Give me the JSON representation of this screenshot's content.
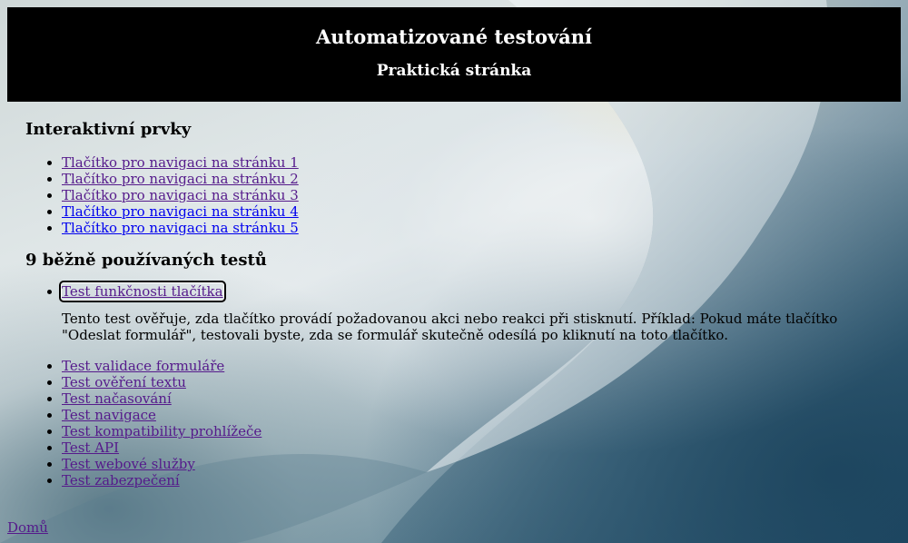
{
  "header": {
    "title": "Automatizované testování",
    "subtitle": "Praktická stránka"
  },
  "interactive": {
    "heading": "Interaktivní prvky",
    "items": [
      {
        "label": "Tlačítko pro navigaci na stránku 1",
        "visited": true
      },
      {
        "label": "Tlačítko pro navigaci na stránku 2",
        "visited": true
      },
      {
        "label": "Tlačítko pro navigaci na stránku 3",
        "visited": true
      },
      {
        "label": "Tlačítko pro navigaci na stránku 4",
        "visited": false
      },
      {
        "label": "Tlačítko pro navigaci na stránku 5",
        "visited": false
      }
    ]
  },
  "tests": {
    "heading": "9 běžně používaných testů",
    "expanded": {
      "label": "Test funkčnosti tlačítka",
      "description": "Tento test ověřuje, zda tlačítko provádí požadovanou akci nebo reakci při stisknutí. Příklad: Pokud máte tlačítko \"Odeslat formulář\", testovali byste, zda se formulář skutečně odesílá po kliknutí na toto tlačítko."
    },
    "items": [
      "Test validace formuláře",
      "Test ověření textu",
      "Test načasování",
      "Test navigace",
      "Test kompatibility prohlížeče",
      "Test API",
      "Test webové služby",
      "Test zabezpečení"
    ]
  },
  "footer": {
    "home_label": "Domů"
  },
  "colors": {
    "header_bg": "#000000",
    "link_visited": "#551a8b",
    "link_unvisited": "#0000ee"
  }
}
